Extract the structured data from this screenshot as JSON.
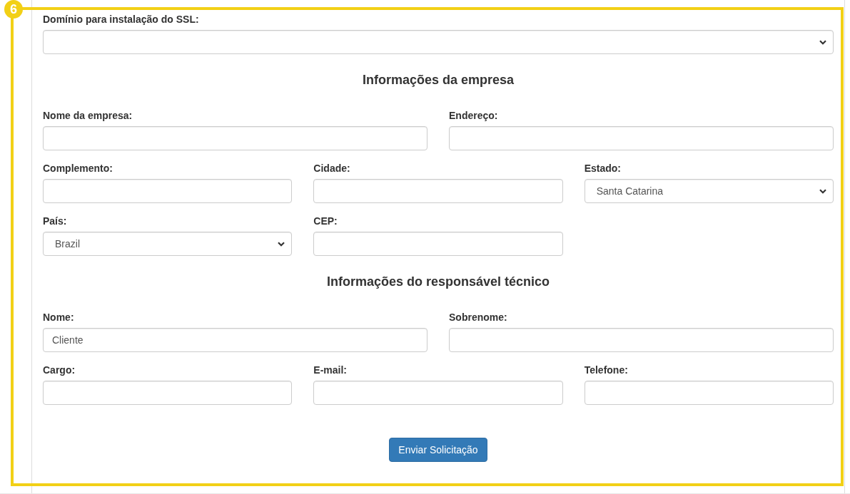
{
  "annotation": {
    "badge": "6"
  },
  "ssl_domain": {
    "label": "Domínio para instalação do SSL:",
    "kind": "select"
  },
  "sections": [
    {
      "title": "Informações da empresa",
      "rows": [
        [
          {
            "label": "Nome da empresa:",
            "kind": "text"
          },
          {
            "label": "Endereço:",
            "kind": "text"
          }
        ],
        [
          {
            "label": "Complemento:",
            "kind": "text"
          },
          {
            "label": "Cidade:",
            "kind": "text"
          },
          {
            "label": "Estado:",
            "kind": "select",
            "value": "Santa Catarina"
          }
        ],
        [
          {
            "label": "País:",
            "kind": "select",
            "value": "Brazil"
          },
          {
            "label": "CEP:",
            "kind": "text"
          }
        ]
      ]
    },
    {
      "title": "Informações do responsável técnico",
      "rows": [
        [
          {
            "label": "Nome:",
            "kind": "text",
            "value": "Cliente"
          },
          {
            "label": "Sobrenome:",
            "kind": "text"
          }
        ],
        [
          {
            "label": "Cargo:",
            "kind": "text"
          },
          {
            "label": "E-mail:",
            "kind": "text"
          },
          {
            "label": "Telefone:",
            "kind": "text"
          }
        ]
      ]
    }
  ],
  "submit_button": "Enviar Solicitação"
}
